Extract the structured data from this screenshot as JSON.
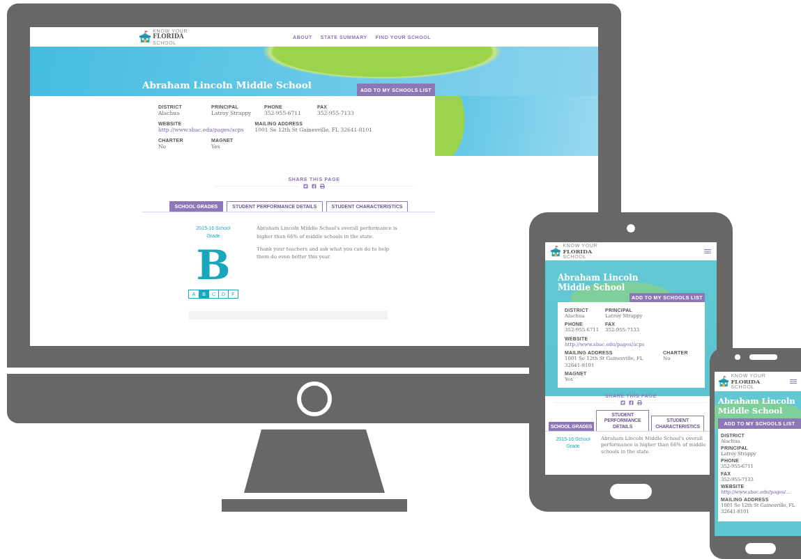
{
  "desktop": {
    "logo": {
      "line_1": "KNOW YOUR",
      "line_2": "FLORIDA",
      "line_3": "SCHOOL"
    },
    "nav": [
      "ABOUT",
      "STATE SUMMARY",
      "FIND YOUR SCHOOL"
    ],
    "school_name": "Abraham Lincoln Middle School",
    "add_button": "ADD TO MY SCHOOLS LIST",
    "field_rows": [
      {
        "fields": [
          {
            "label": "DISTRICT",
            "value": "Alachua",
            "kind": "text"
          },
          {
            "label": "PRINCIPAL",
            "value": "Latroy Strappy",
            "kind": "text"
          },
          {
            "label": "PHONE",
            "value": "352-955-6711",
            "kind": "text"
          },
          {
            "label": "FAX",
            "value": "352-955-7133",
            "kind": "text"
          }
        ]
      },
      {
        "fields": [
          {
            "label": "WEBSITE",
            "value": "http://www.sbac.edu/pages/acps",
            "kind": "link"
          },
          {
            "label": "MAILING ADDRESS",
            "value": "1001 Se 12th St Gainesville, FL 32641-8101",
            "kind": "text"
          }
        ]
      },
      {
        "fields": [
          {
            "label": "CHARTER",
            "value": "No",
            "kind": "text"
          },
          {
            "label": "MAGNET",
            "value": "Yes",
            "kind": "text"
          }
        ]
      }
    ],
    "share": {
      "label": "SHARE THIS PAGE"
    },
    "tabs": [
      {
        "label": "SCHOOL GRADES",
        "selected": true
      },
      {
        "label": "STUDENT PERFORMANCE DETAILS",
        "selected": false
      },
      {
        "label": "STUDENT CHARACTERISTICS",
        "selected": false
      }
    ],
    "grade": {
      "title": "2015-16 School Grade",
      "letter": "B",
      "scale": [
        {
          "label": "A",
          "selected": false
        },
        {
          "label": "B",
          "selected": true
        },
        {
          "label": "C",
          "selected": false
        },
        {
          "label": "D",
          "selected": false
        },
        {
          "label": "F",
          "selected": false
        }
      ]
    },
    "summary": [
      "Abraham Lincoln Middle School's overall performance is higher than 66% of middle schools in the state.",
      "Thank your teachers and ask what you can do to help them do even better this year."
    ]
  },
  "tablet": {
    "logo": {
      "line_1": "KNOW YOUR",
      "line_2": "FLORIDA",
      "line_3": "SCHOOL"
    },
    "school_name": "Abraham Lincoln Middle School",
    "add_button": "ADD TO MY SCHOOLS LIST",
    "field_rows": [
      {
        "fields": [
          {
            "label": "DISTRICT",
            "value": "Alachua",
            "kind": "text"
          },
          {
            "label": "PRINCIPAL",
            "value": "Latroy Strappy",
            "kind": "text"
          }
        ]
      },
      {
        "fields": [
          {
            "label": "PHONE",
            "value": "352-955-6711",
            "kind": "text"
          },
          {
            "label": "FAX",
            "value": "352-955-7133",
            "kind": "text"
          }
        ]
      },
      {
        "fields": [
          {
            "label": "WEBSITE",
            "value": "http://www.sbac.edu/pages/acps",
            "kind": "link"
          }
        ]
      },
      {
        "fields": [
          {
            "label": "MAILING ADDRESS",
            "value": "1001 Se 12th St Gainesville, FL 32641-8101",
            "kind": "text"
          },
          {
            "label": "CHARTER",
            "value": "No",
            "kind": "text"
          }
        ]
      },
      {
        "fields": [
          {
            "label": "MAGNET",
            "value": "Yes",
            "kind": "text"
          }
        ]
      }
    ],
    "share": {
      "label": "SHARE THIS PAGE"
    },
    "tabs": [
      {
        "label": "SCHOOL GRADES",
        "selected": true
      },
      {
        "label": "STUDENT PERFORMANCE DETAILS",
        "selected": false
      },
      {
        "label": "STUDENT CHARACTERISTICS",
        "selected": false
      }
    ],
    "grade": {
      "title": "2015-16 School Grade"
    },
    "summary": [
      "Abraham Lincoln Middle School's overall performance is higher than 66% of middle schools in the state."
    ]
  },
  "phone": {
    "logo": {
      "line_1": "KNOW YOUR",
      "line_2": "FLORIDA",
      "line_3": "SCHOOL"
    },
    "school_name": "Abraham Lincoln Middle School",
    "add_button": "ADD TO MY SCHOOLS LIST",
    "field_rows": [
      {
        "fields": [
          {
            "label": "DISTRICT",
            "value": "Alachua",
            "kind": "text"
          }
        ]
      },
      {
        "fields": [
          {
            "label": "PRINCIPAL",
            "value": "Latroy Strappy",
            "kind": "text"
          }
        ]
      },
      {
        "fields": [
          {
            "label": "PHONE",
            "value": "352-955-6711",
            "kind": "text"
          }
        ]
      },
      {
        "fields": [
          {
            "label": "FAX",
            "value": "352-955-7133",
            "kind": "text"
          }
        ]
      },
      {
        "fields": [
          {
            "label": "WEBSITE",
            "value": "http://www.sbac.edu/pages/…",
            "kind": "link"
          }
        ]
      },
      {
        "fields": [
          {
            "label": "MAILING ADDRESS",
            "value": "1001 Se 12th St Gainesville, FL 32641-8101",
            "kind": "text"
          }
        ]
      }
    ]
  }
}
